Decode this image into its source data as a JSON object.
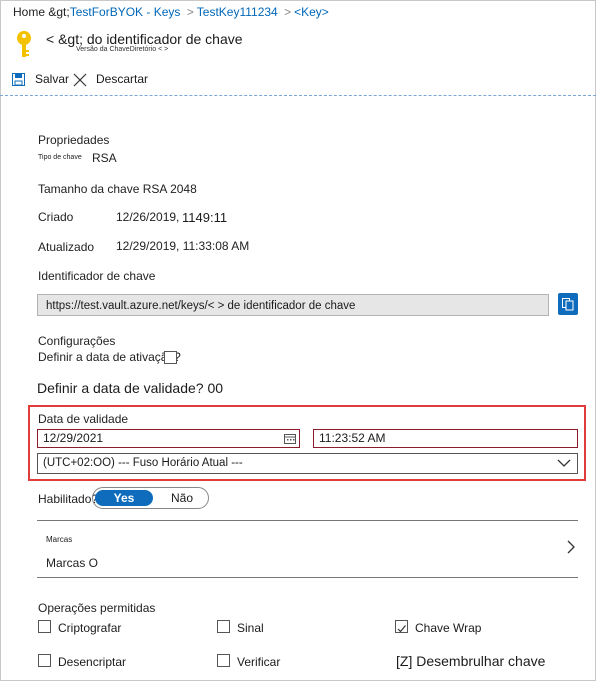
{
  "breadcrumb": {
    "home": "Home &gt;",
    "items": [
      "TestForBYOK - Keys",
      "TestKey111234",
      "<Key>"
    ],
    "separator": ">"
  },
  "header": {
    "title": "< &gt; do identificador de chave",
    "subtitle": "Versão da ChaveDiretório < >"
  },
  "toolbar": {
    "save": "Salvar",
    "discard": "Descartar"
  },
  "properties": {
    "heading": "Propriedades",
    "key_type_label": "Tipo de chave",
    "key_type_value": "RSA",
    "key_size": "Tamanho da chave RSA 2048",
    "created_label": "Criado",
    "created_value": "12/26/2019,",
    "created_time": "1149:11",
    "updated_label": "Atualizado",
    "updated_value": "12/29/2019, 11:33:08 AM",
    "key_id_label": "Identificador de chave",
    "key_id_value": "https://test.vault.azure.net/keys/< > de identificador de chave"
  },
  "settings": {
    "heading": "Configurações",
    "activation_label": "Definir a data de ativação?",
    "expiry_question": "Definir a data de validade? 00",
    "expiry_label": "Data de validade",
    "expiry_date": "12/29/2021",
    "expiry_time": "11:23:52 AM",
    "timezone": "(UTC+02:OO) --- Fuso Horário Atual    ---",
    "enabled_label": "Habilitado?",
    "toggle_yes": "Yes",
    "toggle_no": "Não"
  },
  "tags": {
    "small_label": "Marcas",
    "value": "Marcas O"
  },
  "operations": {
    "heading": "Operações permitidas",
    "items": [
      {
        "label": "Criptografar",
        "checked": false
      },
      {
        "label": "Sinal",
        "checked": false
      },
      {
        "label": "Chave Wrap",
        "checked": true
      },
      {
        "label": "Desencriptar",
        "checked": false
      },
      {
        "label": "Verificar",
        "checked": false
      },
      {
        "label": "[Z] Desembrulhar chave",
        "checked": false
      }
    ]
  },
  "colors": {
    "accent": "#0f6cbd",
    "link": "#0067b8",
    "highlight": "#e03c3c",
    "key_icon": "#f2c200"
  }
}
